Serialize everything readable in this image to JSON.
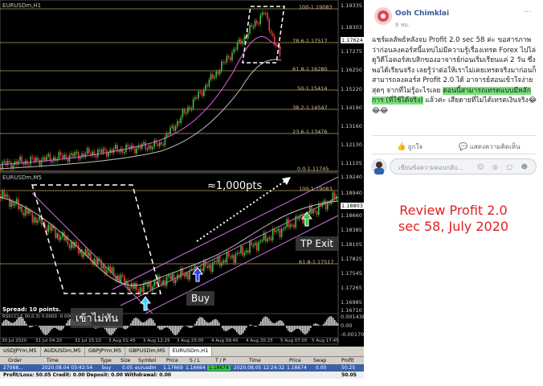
{
  "mt4": {
    "top_chart": {
      "title": "EURUSDm,H1",
      "fib_levels": [
        "100-1.19083",
        "78.6-1.17517",
        "61.8-1.16280",
        "50-1.15414",
        "38.2-1.14547",
        "23.6-1.13476",
        "0.0-1.11745"
      ],
      "price_scale": [
        "1.19335",
        "1.18303",
        "1.17275",
        "1.16250",
        "1.15220",
        "1.14190",
        "1.13160",
        "1.12130",
        "1.11105"
      ],
      "price_tag": "1.17624"
    },
    "bottom_chart": {
      "title": "EURUSDm,M5",
      "fib_levels": [
        "100-1.19083",
        "61.8-1.17517"
      ],
      "price_scale": [
        "1.19240",
        "1.18940",
        "1.18660",
        "1.18385",
        "1.18105",
        "1.17825",
        "1.17545",
        "1.17265",
        "1.16985",
        "1.16710"
      ],
      "price_tag": "1.18803",
      "spread": "Spread: 10 points.",
      "indicator_label": "RSI(CCI,5,30,0.3) 0.0000 -0.0002068",
      "indicator_scale": [
        "0.001438",
        "0.00",
        "-0.001702"
      ],
      "time_labels": [
        "30 Jul 2020",
        "31 Jul 04:20",
        "31 Jul 15:10",
        "3 Aug 01:45",
        "3 Aug 12:25",
        "3 Aug 23:05",
        "4 Aug 09:45",
        "4 Aug 20:25",
        "5 Aug 07:05",
        "5 Aug 17:45"
      ]
    },
    "annotations": {
      "pts": "≈1,000pts",
      "buy": "Buy",
      "tp_exit": "TP Exit",
      "late": "เข้าไม่ทัน"
    },
    "tabs": [
      "USDJPYm,M5",
      "AUDUSDm,M5",
      "GBPJPYm,M5",
      "GBPUSDm,M5",
      "EURUSDm,H1"
    ],
    "active_tab": "EURUSDm,H1",
    "terminal": {
      "headers": [
        "Order",
        "Time",
        "Type",
        "Size",
        "Symbol",
        "Price",
        "S / L",
        "T / P",
        "Time",
        "Price",
        "Swap",
        "Profit"
      ],
      "row": [
        "27068...",
        "2020.08.04 03:42:54",
        "buy",
        "0.05",
        "eurusdm",
        "1.17669",
        "1.16664",
        "1.18674",
        "2020.08.05 12:24:32",
        "1.18674",
        "0.00",
        "50.25"
      ],
      "footer": "Profit/Loss: 50.05  Credit: 0.00  Deposit: 0.00  Withdrawal: 0.00",
      "footer_total": "50.05"
    }
  },
  "facebook": {
    "author": "Ooh Chimklai",
    "time": "6 ชม.",
    "more": "···",
    "post_before": "แชร์ผลลัพธ์หลังจบ Profit 2.0 sec 58 ค่ะ ขอสารภาพว่าก่อนลงคอร์สนี้แทบไม่มีความรู้เรื่องเทรด Forex ไปไล่ดูวิดีโอคอร์สเบสิกของอาจารย์ก่อนเริ่มเรียนแค่ 2 วัน ซึ่งพอได้เรียนจริง เลยรู้ว่าต่อให้เราไม่เคยเทรดจริงมาก่อนก็สามารถลงคอร์ส Profit 2.0 ได้ อาจารย์สอนเข้าใจง่ายสุดๆ จากที่ไม่รู้อะไรเลย ",
    "post_highlight": "ตอนนี้สามารถเทรดแบบมีหลักการ (ที่ใช้ได้จริง)",
    "post_after": " แล้วค่ะ เสียดายที่ไม่ได้เทรดเงินจริง😂😂😂",
    "like": "ถูกใจ",
    "comment": "แสดงความคิดเห็น",
    "comment_placeholder": "เขียนข้อความตอบกลับ...",
    "comment_icons": "☺ ◎ ▢ ☻"
  },
  "review": {
    "line1": "Review Profit 2.0",
    "line2": "sec 58, July 2020"
  }
}
